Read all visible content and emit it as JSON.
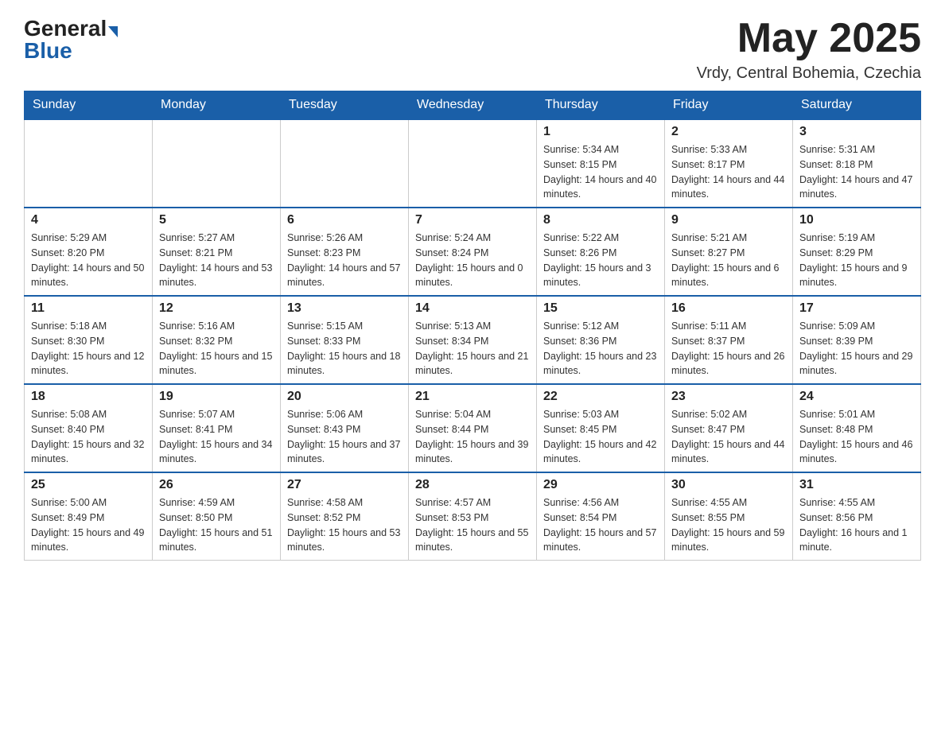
{
  "header": {
    "logo_general": "General",
    "logo_blue": "Blue",
    "month_title": "May 2025",
    "location": "Vrdy, Central Bohemia, Czechia"
  },
  "days_of_week": [
    "Sunday",
    "Monday",
    "Tuesday",
    "Wednesday",
    "Thursday",
    "Friday",
    "Saturday"
  ],
  "weeks": [
    [
      {
        "day": "",
        "info": ""
      },
      {
        "day": "",
        "info": ""
      },
      {
        "day": "",
        "info": ""
      },
      {
        "day": "",
        "info": ""
      },
      {
        "day": "1",
        "info": "Sunrise: 5:34 AM\nSunset: 8:15 PM\nDaylight: 14 hours and 40 minutes."
      },
      {
        "day": "2",
        "info": "Sunrise: 5:33 AM\nSunset: 8:17 PM\nDaylight: 14 hours and 44 minutes."
      },
      {
        "day": "3",
        "info": "Sunrise: 5:31 AM\nSunset: 8:18 PM\nDaylight: 14 hours and 47 minutes."
      }
    ],
    [
      {
        "day": "4",
        "info": "Sunrise: 5:29 AM\nSunset: 8:20 PM\nDaylight: 14 hours and 50 minutes."
      },
      {
        "day": "5",
        "info": "Sunrise: 5:27 AM\nSunset: 8:21 PM\nDaylight: 14 hours and 53 minutes."
      },
      {
        "day": "6",
        "info": "Sunrise: 5:26 AM\nSunset: 8:23 PM\nDaylight: 14 hours and 57 minutes."
      },
      {
        "day": "7",
        "info": "Sunrise: 5:24 AM\nSunset: 8:24 PM\nDaylight: 15 hours and 0 minutes."
      },
      {
        "day": "8",
        "info": "Sunrise: 5:22 AM\nSunset: 8:26 PM\nDaylight: 15 hours and 3 minutes."
      },
      {
        "day": "9",
        "info": "Sunrise: 5:21 AM\nSunset: 8:27 PM\nDaylight: 15 hours and 6 minutes."
      },
      {
        "day": "10",
        "info": "Sunrise: 5:19 AM\nSunset: 8:29 PM\nDaylight: 15 hours and 9 minutes."
      }
    ],
    [
      {
        "day": "11",
        "info": "Sunrise: 5:18 AM\nSunset: 8:30 PM\nDaylight: 15 hours and 12 minutes."
      },
      {
        "day": "12",
        "info": "Sunrise: 5:16 AM\nSunset: 8:32 PM\nDaylight: 15 hours and 15 minutes."
      },
      {
        "day": "13",
        "info": "Sunrise: 5:15 AM\nSunset: 8:33 PM\nDaylight: 15 hours and 18 minutes."
      },
      {
        "day": "14",
        "info": "Sunrise: 5:13 AM\nSunset: 8:34 PM\nDaylight: 15 hours and 21 minutes."
      },
      {
        "day": "15",
        "info": "Sunrise: 5:12 AM\nSunset: 8:36 PM\nDaylight: 15 hours and 23 minutes."
      },
      {
        "day": "16",
        "info": "Sunrise: 5:11 AM\nSunset: 8:37 PM\nDaylight: 15 hours and 26 minutes."
      },
      {
        "day": "17",
        "info": "Sunrise: 5:09 AM\nSunset: 8:39 PM\nDaylight: 15 hours and 29 minutes."
      }
    ],
    [
      {
        "day": "18",
        "info": "Sunrise: 5:08 AM\nSunset: 8:40 PM\nDaylight: 15 hours and 32 minutes."
      },
      {
        "day": "19",
        "info": "Sunrise: 5:07 AM\nSunset: 8:41 PM\nDaylight: 15 hours and 34 minutes."
      },
      {
        "day": "20",
        "info": "Sunrise: 5:06 AM\nSunset: 8:43 PM\nDaylight: 15 hours and 37 minutes."
      },
      {
        "day": "21",
        "info": "Sunrise: 5:04 AM\nSunset: 8:44 PM\nDaylight: 15 hours and 39 minutes."
      },
      {
        "day": "22",
        "info": "Sunrise: 5:03 AM\nSunset: 8:45 PM\nDaylight: 15 hours and 42 minutes."
      },
      {
        "day": "23",
        "info": "Sunrise: 5:02 AM\nSunset: 8:47 PM\nDaylight: 15 hours and 44 minutes."
      },
      {
        "day": "24",
        "info": "Sunrise: 5:01 AM\nSunset: 8:48 PM\nDaylight: 15 hours and 46 minutes."
      }
    ],
    [
      {
        "day": "25",
        "info": "Sunrise: 5:00 AM\nSunset: 8:49 PM\nDaylight: 15 hours and 49 minutes."
      },
      {
        "day": "26",
        "info": "Sunrise: 4:59 AM\nSunset: 8:50 PM\nDaylight: 15 hours and 51 minutes."
      },
      {
        "day": "27",
        "info": "Sunrise: 4:58 AM\nSunset: 8:52 PM\nDaylight: 15 hours and 53 minutes."
      },
      {
        "day": "28",
        "info": "Sunrise: 4:57 AM\nSunset: 8:53 PM\nDaylight: 15 hours and 55 minutes."
      },
      {
        "day": "29",
        "info": "Sunrise: 4:56 AM\nSunset: 8:54 PM\nDaylight: 15 hours and 57 minutes."
      },
      {
        "day": "30",
        "info": "Sunrise: 4:55 AM\nSunset: 8:55 PM\nDaylight: 15 hours and 59 minutes."
      },
      {
        "day": "31",
        "info": "Sunrise: 4:55 AM\nSunset: 8:56 PM\nDaylight: 16 hours and 1 minute."
      }
    ]
  ]
}
